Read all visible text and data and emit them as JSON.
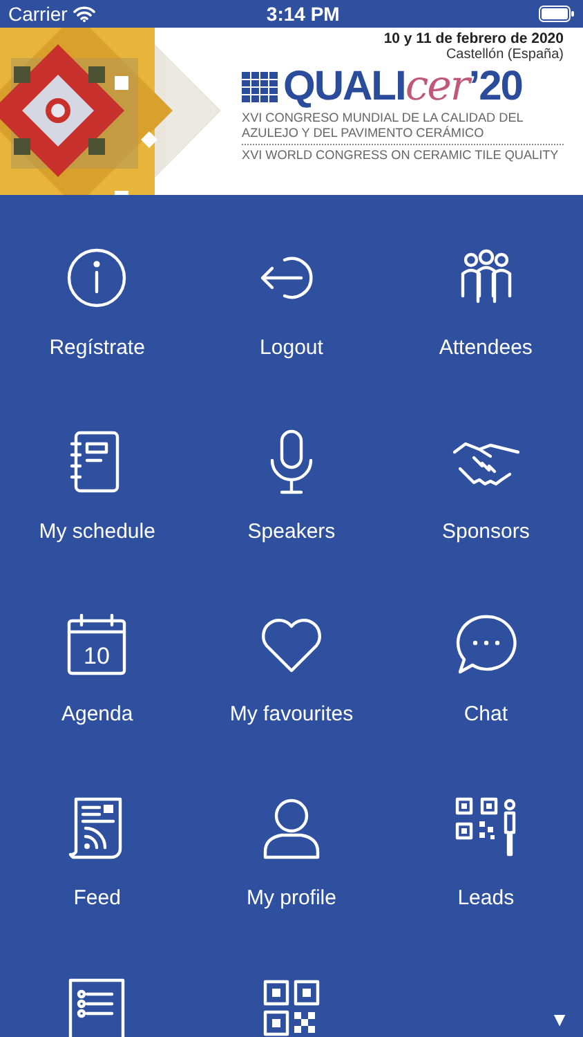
{
  "status_bar": {
    "carrier": "Carrier",
    "time": "3:14 PM"
  },
  "banner": {
    "dates": "10 y 11 de febrero de 2020",
    "place": "Castellón (España)",
    "logo": [
      "QUALI",
      "cer",
      "’20"
    ],
    "line_1": "XVI CONGRESO MUNDIAL DE LA CALIDAD DEL",
    "line_2": "AZULEJO Y DEL PAVIMENTO CERÁMICO",
    "line_3": "XVI WORLD CONGRESS ON CERAMIC TILE QUALITY"
  },
  "menu": [
    {
      "kind": "info",
      "label": "Regístrate"
    },
    {
      "kind": "logout",
      "label": "Logout"
    },
    {
      "kind": "attendees",
      "label": "Attendees"
    },
    {
      "kind": "notebook",
      "label": "My schedule"
    },
    {
      "kind": "microphone",
      "label": "Speakers"
    },
    {
      "kind": "handshake",
      "label": "Sponsors"
    },
    {
      "kind": "calendar",
      "label": "Agenda",
      "day": "10"
    },
    {
      "kind": "heart",
      "label": "My favourites"
    },
    {
      "kind": "chat",
      "label": "Chat"
    },
    {
      "kind": "feed",
      "label": "Feed"
    },
    {
      "kind": "profile",
      "label": "My profile"
    },
    {
      "kind": "leads",
      "label": "Leads"
    },
    {
      "kind": "list"
    },
    {
      "kind": "qr"
    }
  ],
  "scroll_arrow": "▼"
}
